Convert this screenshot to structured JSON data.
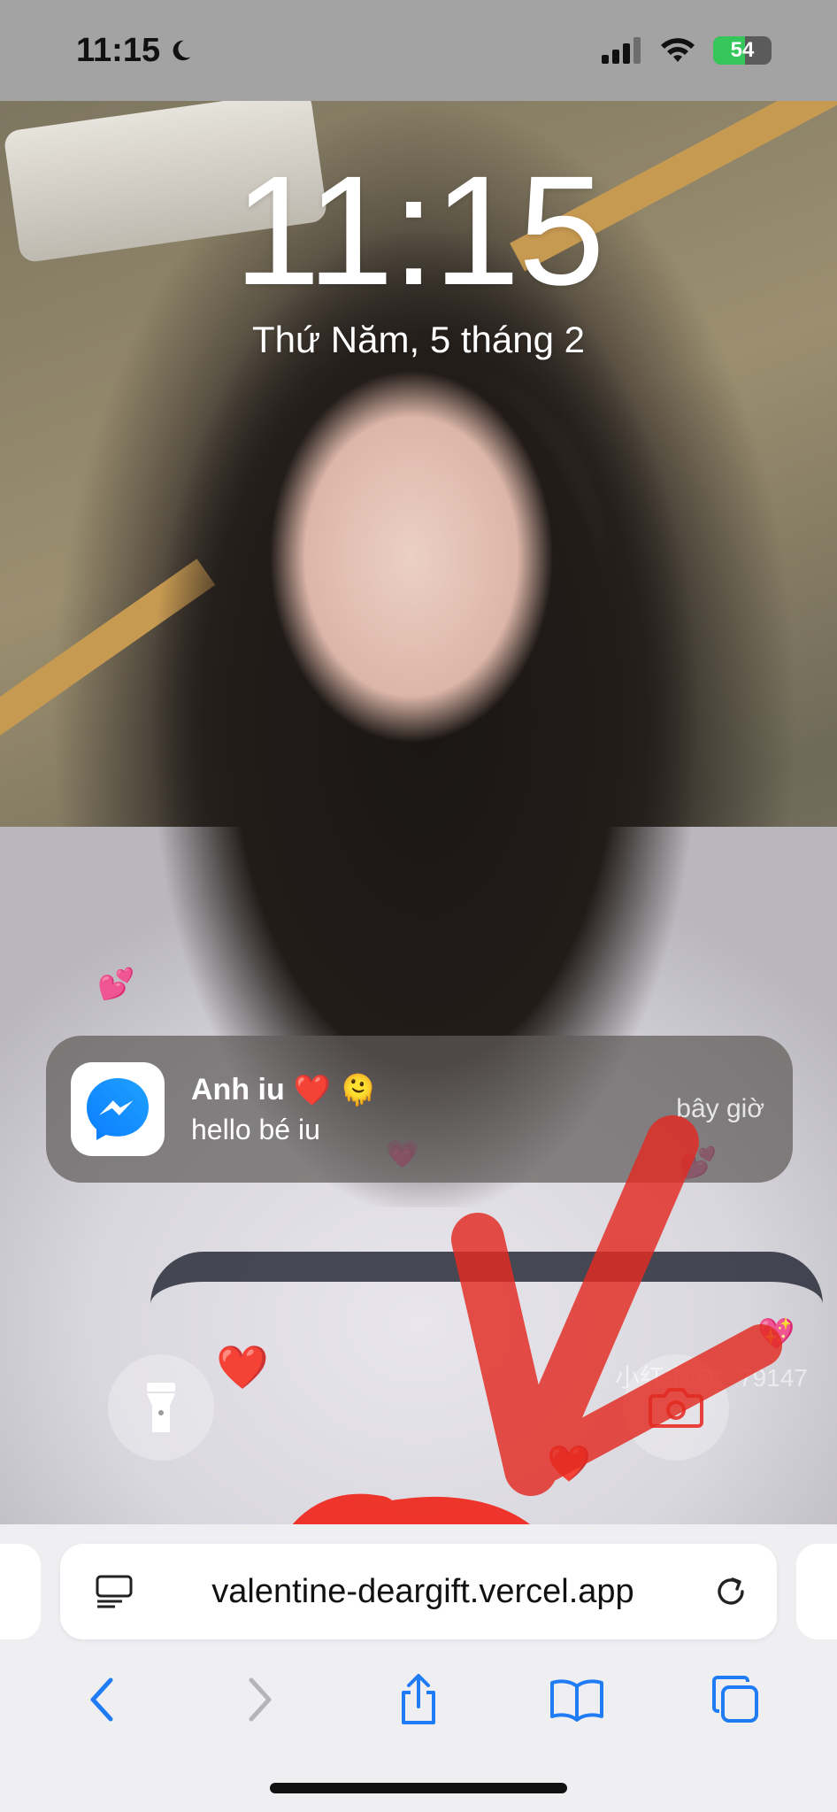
{
  "status_bar": {
    "time": "11:15",
    "focus_icon": "moon-icon",
    "battery_level": "54",
    "battery_charging": true
  },
  "lock_screen": {
    "time": "11:15",
    "date": "Thứ Năm, 5 tháng 2"
  },
  "notification": {
    "app_icon": "messenger-icon",
    "sender": "Anh iu",
    "sender_emoji": "❤️ 🫠",
    "message": "hello bé iu",
    "time": "bây giờ"
  },
  "lock_buttons": {
    "left": "flashlight-icon",
    "right": "camera-icon"
  },
  "watermark": "小红书ID：79147",
  "browser": {
    "url": "valentine-deargift.vercel.app",
    "page_menu_icon": "page-menu-icon",
    "reload_icon": "reload-icon",
    "toolbar": [
      "back-icon",
      "forward-icon",
      "share-icon",
      "bookmarks-icon",
      "tabs-icon"
    ]
  },
  "colors": {
    "status_bar_bg": "#a3a3a3",
    "accent_blue": "#1f7cf5",
    "battery_green": "#35c759",
    "annotation_red": "#e32a22",
    "safari_bar_bg": "#efeff2"
  }
}
